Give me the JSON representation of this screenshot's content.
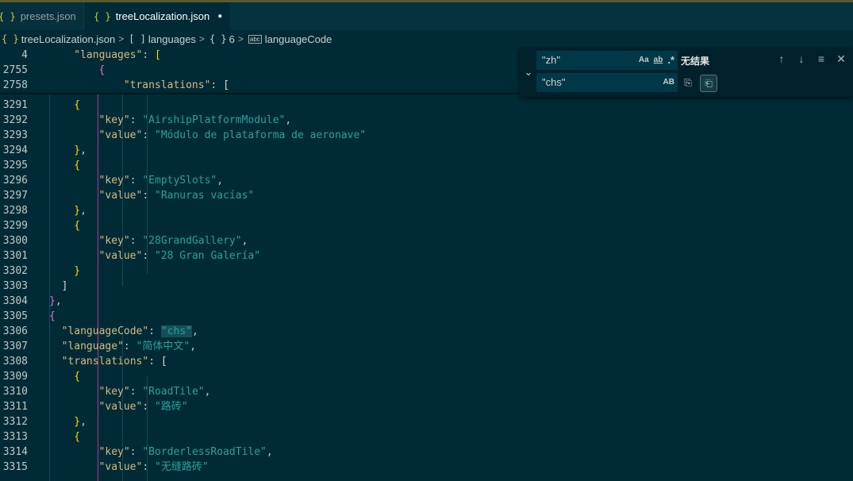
{
  "tabs": [
    {
      "label": "presets.json",
      "icon": "{ }"
    },
    {
      "label": "treeLocalization.json",
      "icon": "{ }",
      "dirty": "●"
    }
  ],
  "breadcrumb": {
    "file": "treeLocalization.json",
    "file_icon": "{ }",
    "array_icon": "[ ]",
    "array": "languages",
    "obj_icon": "{ }",
    "obj": "6",
    "prop_icon": "abc",
    "prop": "languageCode",
    "sep": ">"
  },
  "find": {
    "search_value": "\"zh\"",
    "replace_value": "\"chs\"",
    "opt_case": "Aa",
    "opt_word": "ab",
    "opt_regex": ".*",
    "opt_preserve_case": "AB",
    "result": "无结果",
    "toggle_icon": "⌄",
    "prev_icon": "↑",
    "next_icon": "↓",
    "selection_icon": "≡",
    "close_icon": "✕",
    "replace_icon": "⎘",
    "replace_all_icon": "⎗"
  },
  "sticky": [
    {
      "ln": "4",
      "t": [
        [
          "k",
          "\"languages\""
        ],
        [
          "p",
          ": "
        ],
        [
          "bk1",
          "["
        ]
      ]
    },
    {
      "ln": "2755",
      "t": [
        [
          "bk2",
          "{"
        ]
      ]
    },
    {
      "ln": "2758",
      "t": [
        [
          "k",
          "\"translations\""
        ],
        [
          "p",
          ": "
        ],
        [
          "bk3",
          "["
        ]
      ]
    }
  ],
  "lines": [
    {
      "ln": "3291",
      "indent": 8,
      "t": [
        [
          "bk1",
          "{"
        ]
      ]
    },
    {
      "ln": "3292",
      "indent": 12,
      "t": [
        [
          "k",
          "\"key\""
        ],
        [
          "p",
          ": "
        ],
        [
          "s",
          "\"AirshipPlatformModule\""
        ],
        [
          "p",
          ","
        ]
      ]
    },
    {
      "ln": "3293",
      "indent": 12,
      "t": [
        [
          "k",
          "\"value\""
        ],
        [
          "p",
          ": "
        ],
        [
          "s",
          "\"Módulo de plataforma de aeronave\""
        ]
      ]
    },
    {
      "ln": "3294",
      "indent": 8,
      "t": [
        [
          "bk1",
          "}"
        ],
        [
          "p",
          ","
        ]
      ]
    },
    {
      "ln": "3295",
      "indent": 8,
      "t": [
        [
          "bk1",
          "{"
        ]
      ]
    },
    {
      "ln": "3296",
      "indent": 12,
      "t": [
        [
          "k",
          "\"key\""
        ],
        [
          "p",
          ": "
        ],
        [
          "s",
          "\"EmptySlots\""
        ],
        [
          "p",
          ","
        ]
      ]
    },
    {
      "ln": "3297",
      "indent": 12,
      "t": [
        [
          "k",
          "\"value\""
        ],
        [
          "p",
          ": "
        ],
        [
          "s",
          "\"Ranuras vacías\""
        ]
      ]
    },
    {
      "ln": "3298",
      "indent": 8,
      "t": [
        [
          "bk1",
          "}"
        ],
        [
          "p",
          ","
        ]
      ]
    },
    {
      "ln": "3299",
      "indent": 8,
      "t": [
        [
          "bk1",
          "{"
        ]
      ]
    },
    {
      "ln": "3300",
      "indent": 12,
      "t": [
        [
          "k",
          "\"key\""
        ],
        [
          "p",
          ": "
        ],
        [
          "s",
          "\"28GrandGallery\""
        ],
        [
          "p",
          ","
        ]
      ]
    },
    {
      "ln": "3301",
      "indent": 12,
      "t": [
        [
          "k",
          "\"value\""
        ],
        [
          "p",
          ": "
        ],
        [
          "s",
          "\"28 Gran Galería\""
        ]
      ]
    },
    {
      "ln": "3302",
      "indent": 8,
      "t": [
        [
          "bk1",
          "}"
        ]
      ]
    },
    {
      "ln": "3303",
      "indent": 6,
      "t": [
        [
          "bk3",
          "]"
        ]
      ]
    },
    {
      "ln": "3304",
      "indent": 4,
      "t": [
        [
          "bk2",
          "}"
        ],
        [
          "p",
          ","
        ]
      ]
    },
    {
      "ln": "3305",
      "indent": 4,
      "t": [
        [
          "bk2",
          "{"
        ]
      ]
    },
    {
      "ln": "3306",
      "indent": 6,
      "t": [
        [
          "k",
          "\"languageCode\""
        ],
        [
          "p",
          ": "
        ],
        [
          "shl",
          "\"chs\""
        ],
        [
          "p",
          ","
        ]
      ]
    },
    {
      "ln": "3307",
      "indent": 6,
      "t": [
        [
          "k",
          "\"language\""
        ],
        [
          "p",
          ": "
        ],
        [
          "s",
          "\"简体中文\""
        ],
        [
          "p",
          ","
        ]
      ]
    },
    {
      "ln": "3308",
      "indent": 6,
      "t": [
        [
          "k",
          "\"translations\""
        ],
        [
          "p",
          ": "
        ],
        [
          "bk3",
          "["
        ]
      ]
    },
    {
      "ln": "3309",
      "indent": 8,
      "t": [
        [
          "bk1",
          "{"
        ]
      ]
    },
    {
      "ln": "3310",
      "indent": 12,
      "t": [
        [
          "k",
          "\"key\""
        ],
        [
          "p",
          ": "
        ],
        [
          "s",
          "\"RoadTile\""
        ],
        [
          "p",
          ","
        ]
      ]
    },
    {
      "ln": "3311",
      "indent": 12,
      "t": [
        [
          "k",
          "\"value\""
        ],
        [
          "p",
          ": "
        ],
        [
          "s",
          "\"路砖\""
        ]
      ]
    },
    {
      "ln": "3312",
      "indent": 8,
      "t": [
        [
          "bk1",
          "}"
        ],
        [
          "p",
          ","
        ]
      ]
    },
    {
      "ln": "3313",
      "indent": 8,
      "t": [
        [
          "bk1",
          "{"
        ]
      ]
    },
    {
      "ln": "3314",
      "indent": 12,
      "t": [
        [
          "k",
          "\"key\""
        ],
        [
          "p",
          ": "
        ],
        [
          "s",
          "\"BorderlessRoadTile\""
        ],
        [
          "p",
          ","
        ]
      ]
    },
    {
      "ln": "3315",
      "indent": 12,
      "t": [
        [
          "k",
          "\"value\""
        ],
        [
          "p",
          ": "
        ],
        [
          "s",
          "\"无缝路砖\""
        ]
      ]
    }
  ],
  "colors": {
    "background": "#002b36",
    "key": "#d7ba7d",
    "string": "#2aa198",
    "bracket_1": "#ffd700",
    "bracket_2": "#da70d6"
  }
}
